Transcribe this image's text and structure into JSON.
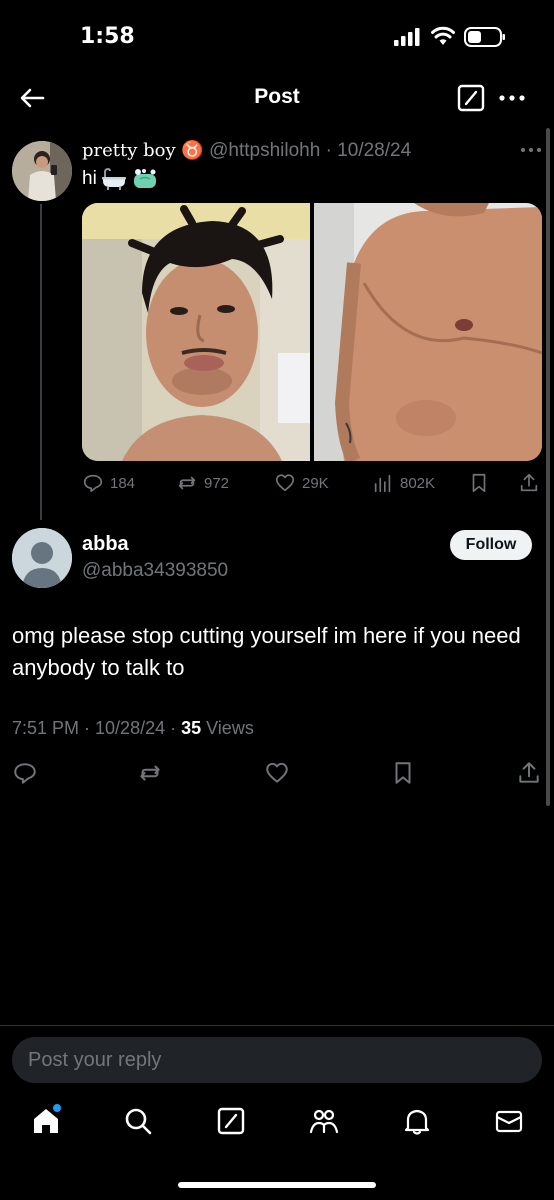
{
  "status_bar": {
    "time": "1:58"
  },
  "header": {
    "title": "Post"
  },
  "original_post": {
    "display_name": "pretty boy ♉",
    "handle": "@httpshilohh",
    "date": "10/28/24",
    "text": "hi",
    "stats": {
      "replies": "184",
      "reposts": "972",
      "likes": "29K",
      "views": "802K"
    }
  },
  "reply_post": {
    "display_name": "abba",
    "handle": "@abba34393850",
    "follow_label": "Follow",
    "text": "omg please stop cutting yourself im here if you need anybody to talk to",
    "time": "7:51 PM · 10/28/24 · ",
    "views_count": "35",
    "views_label": " Views"
  },
  "composer": {
    "placeholder": "Post your reply"
  },
  "icons": {
    "back": "arrow-left-icon",
    "compose": "compose-icon",
    "more": "more-horizontal-icon",
    "reply": "reply-icon",
    "repost": "repost-icon",
    "like": "heart-icon",
    "views": "views-icon",
    "bookmark": "bookmark-icon",
    "share": "share-icon",
    "home": "home-icon",
    "search": "search-icon",
    "communities": "communities-icon",
    "notifications": "bell-icon",
    "messages": "mail-icon"
  },
  "colors": {
    "background": "#000000",
    "text": "#e7e9ea",
    "muted": "#71767b",
    "accent": "#1d9bf0"
  }
}
